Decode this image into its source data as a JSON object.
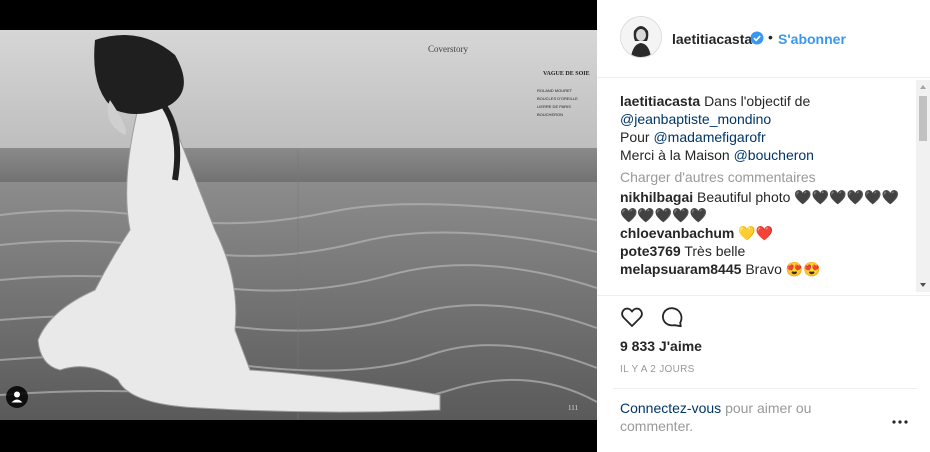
{
  "post": {
    "image_alt": "Noir et blanc photo",
    "magazine_header": "Coverstory",
    "magazine_caption_title": "VAGUE DE SOIE",
    "magazine_caption_lines": [
      "ROLAND MOURET",
      "BOUCLES D'OREILLE",
      "LIERRE DE PARIS",
      "BOUCHERON"
    ],
    "page_number": "111"
  },
  "header": {
    "username": "laetitiacasta",
    "separator": "•",
    "follow_label": "S'abonner",
    "verified_icon": "verified-badge-icon"
  },
  "caption": {
    "username": "laetitiacasta",
    "text1": "Dans l'objectif de",
    "mention1": "@jeanbaptiste_mondino",
    "text2": "Pour",
    "mention2": "@madamefigarofr",
    "text3": "Merci à la Maison",
    "mention3": "@boucheron"
  },
  "load_more": "Charger d'autres commentaires",
  "comments": [
    {
      "user": "nikhilbagai",
      "text": "Beautiful photo 🖤🖤🖤🖤🖤🖤🖤🖤🖤🖤🖤"
    },
    {
      "user": "chloevanbachum",
      "text": "💛❤️"
    },
    {
      "user": "pote3769",
      "text": "Très belle"
    },
    {
      "user": "melapsuaram8445",
      "text": "Bravo 😍😍"
    }
  ],
  "actions": {
    "like_icon": "heart-icon",
    "comment_icon": "comment-icon"
  },
  "likes": "9 833 J'aime",
  "time_ago": "IL Y A 2 JOURS",
  "login_prompt": {
    "link": "Connectez-vous",
    "text": "pour aimer ou commenter."
  },
  "more_icon": "more-options-icon",
  "colors": {
    "accent": "#3897f0",
    "link": "#003569",
    "muted": "#999999",
    "text": "#262626"
  }
}
